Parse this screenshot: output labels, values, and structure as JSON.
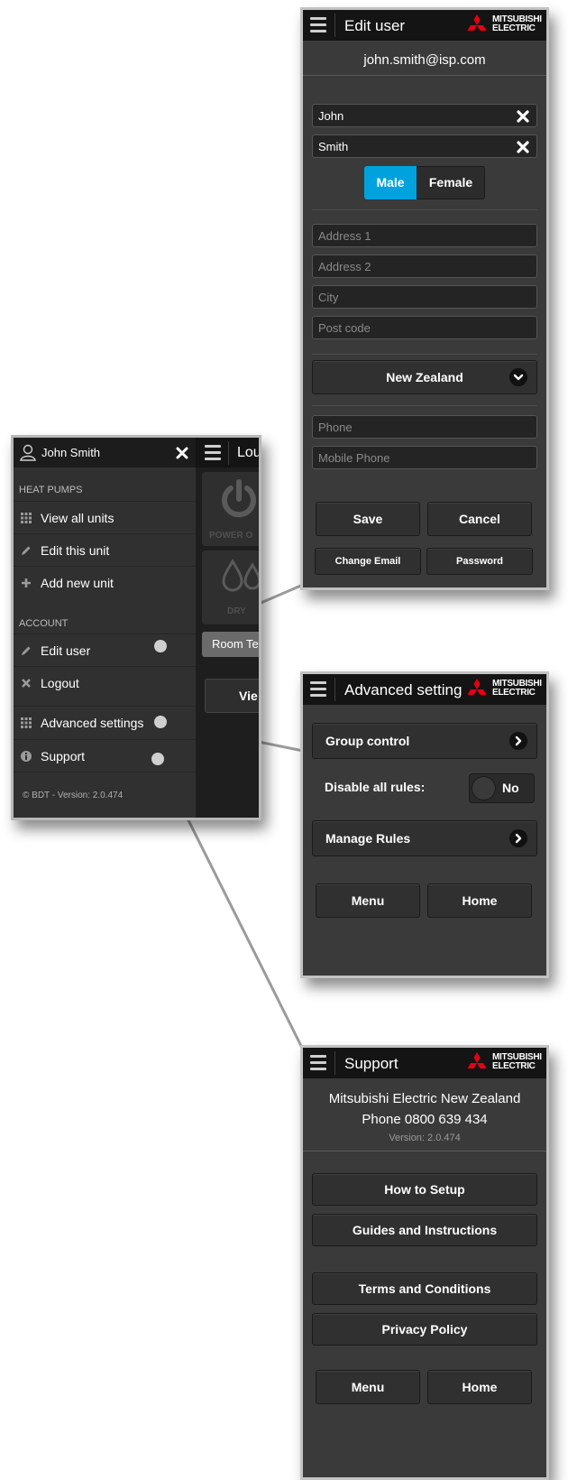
{
  "edit_user": {
    "title": "Edit user",
    "email": "john.smith@isp.com",
    "first_name": "John",
    "last_name": "Smith",
    "gender_options": [
      "Male",
      "Female"
    ],
    "gender_selected": "Male",
    "address1_placeholder": "Address 1",
    "address2_placeholder": "Address 2",
    "city_placeholder": "City",
    "postcode_placeholder": "Post code",
    "country": "New Zealand",
    "phone_placeholder": "Phone",
    "mobile_placeholder": "Mobile Phone",
    "save_label": "Save",
    "cancel_label": "Cancel",
    "change_email_label": "Change Email",
    "password_label": "Password"
  },
  "brand": {
    "line1": "MITSUBISHI",
    "line2": "ELECTRIC",
    "red": "#e60012"
  },
  "menu": {
    "user_name": "John Smith",
    "section_heat_pumps": "HEAT PUMPS",
    "view_all_units": "View all units",
    "edit_this_unit": "Edit this unit",
    "add_new_unit": "Add new unit",
    "section_account": "ACCOUNT",
    "edit_user": "Edit user",
    "logout": "Logout",
    "advanced_settings": "Advanced settings",
    "support": "Support",
    "version": "© BDT - Version: 2.0.474",
    "behind_title": "Lou",
    "behind_power": "POWER O",
    "behind_dry": "DRY",
    "behind_room": "Room Te",
    "behind_view": "Vie"
  },
  "advanced": {
    "title": "Advanced setting",
    "group_control": "Group control",
    "disable_rules_label": "Disable all rules:",
    "disable_rules_value": "No",
    "manage_rules": "Manage Rules",
    "menu_label": "Menu",
    "home_label": "Home"
  },
  "support": {
    "title": "Support",
    "company": "Mitsubishi Electric New Zealand",
    "phone": "Phone 0800 639 434",
    "version": "Version: 2.0.474",
    "how_to_setup": "How to Setup",
    "guides": "Guides and Instructions",
    "terms": "Terms and Conditions",
    "privacy": "Privacy Policy",
    "menu_label": "Menu",
    "home_label": "Home"
  },
  "colors": {
    "accent": "#00a2dd",
    "background": "#3a3a3a",
    "topbar": "#141414"
  }
}
